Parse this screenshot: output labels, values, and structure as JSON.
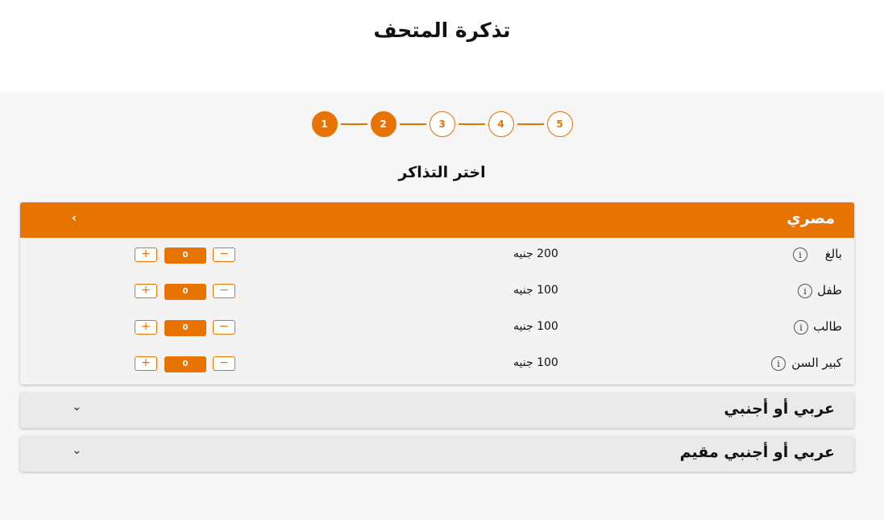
{
  "page_title": "تذكرة المتحف",
  "steps": [
    "1",
    "2",
    "3",
    "4",
    "5"
  ],
  "active_steps": 2,
  "section_title": "اختر التذاكر",
  "categories": [
    {
      "title": "مصري",
      "expanded": true,
      "chevron": "‹",
      "rows": [
        {
          "label": "بالغ",
          "price": "200 جنيه",
          "qty": "0"
        },
        {
          "label": "طفل",
          "price": "100 جنيه",
          "qty": "0"
        },
        {
          "label": "طالب",
          "price": "100 جنيه",
          "qty": "0"
        },
        {
          "label": "كبير السن",
          "price": "100 جنيه",
          "qty": "0"
        }
      ]
    },
    {
      "title": "عربي أو أجنبي",
      "expanded": false,
      "chevron": "⌄"
    },
    {
      "title": "عربي أو أجنبي مقيم",
      "expanded": false,
      "chevron": "⌄"
    }
  ],
  "controls": {
    "plus": "+",
    "minus": "−",
    "info": "i"
  },
  "colors": {
    "accent": "#e77300",
    "background": "#f6f6f6"
  }
}
